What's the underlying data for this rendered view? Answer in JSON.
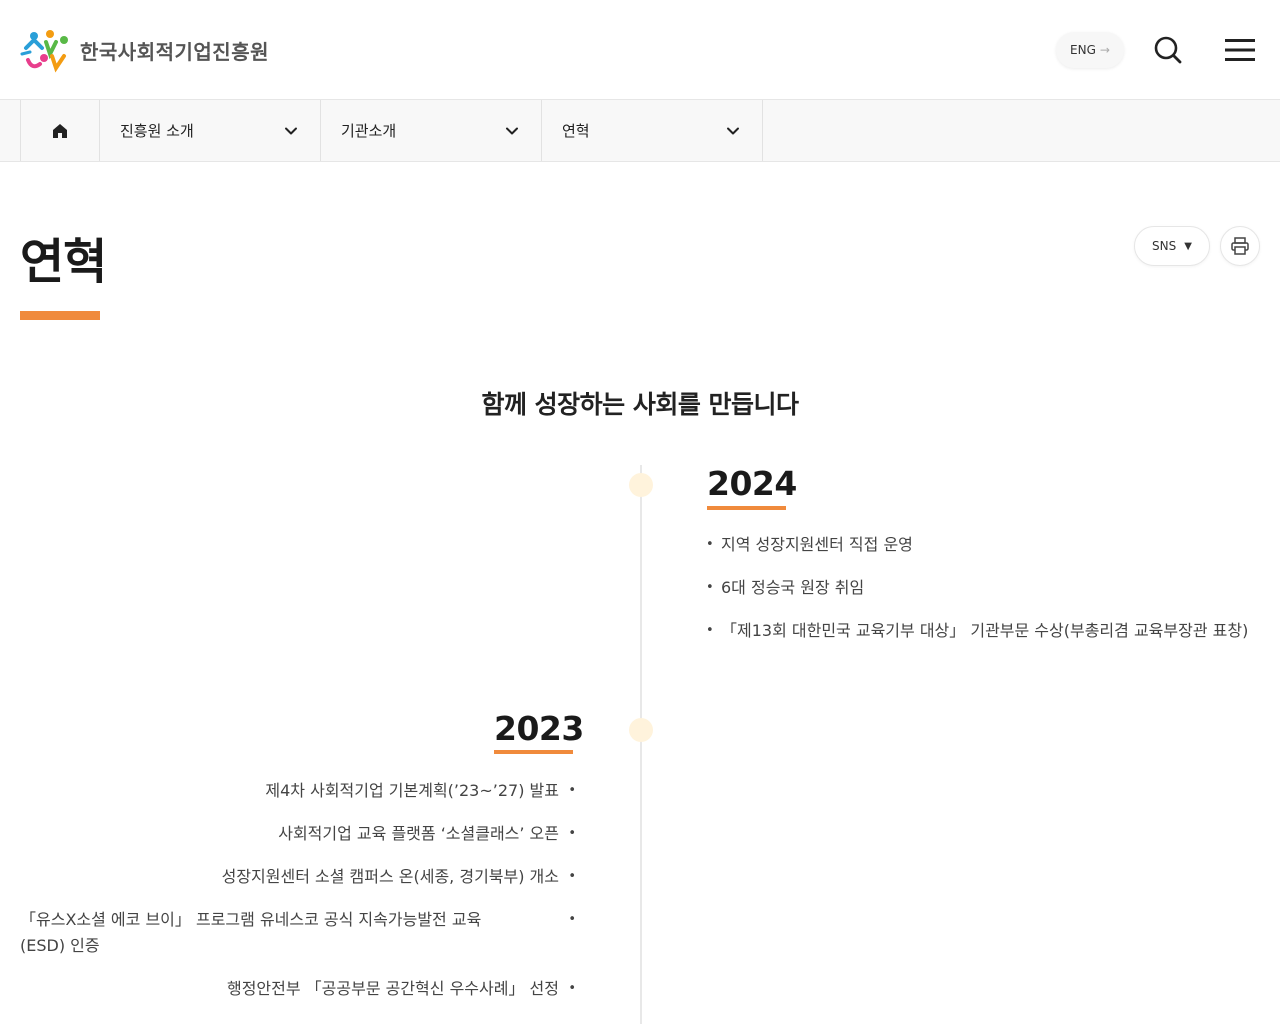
{
  "header": {
    "logo_text": "한국사회적기업진흥원",
    "eng_label": "ENG",
    "colors": {
      "accent": "#f08a3c",
      "logo_blue": "#2a9fd8",
      "logo_green": "#59b947",
      "logo_pink": "#e83e8c",
      "logo_orange": "#f39c12"
    }
  },
  "nav": {
    "items": [
      {
        "label": "진흥원 소개"
      },
      {
        "label": "기관소개"
      },
      {
        "label": "연혁"
      }
    ]
  },
  "page": {
    "title": "연혁",
    "sns_label": "SNS",
    "subtitle": "함께 성장하는 사회를 만듭니다"
  },
  "timeline": [
    {
      "year": "2024",
      "events": [
        "지역 성장지원센터 직접 운영",
        "6대 정승국 원장 취임",
        "「제13회 대한민국 교육기부 대상」 기관부문 수상(부총리겸 교육부장관 표창)"
      ]
    },
    {
      "year": "2023",
      "events": [
        "제4차 사회적기업 기본계획(’23~’27) 발표",
        "사회적기업 교육 플랫폼 ‘소셜클래스’ 오픈",
        "성장지원센터 소셜 캠퍼스 온(세종, 경기북부) 개소",
        "「유스X소셜 에코 브이」 프로그램 유네스코 공식 지속가능발전 교육(ESD) 인증",
        "행정안전부 「공공부문 공간혁신 우수사례」 선정"
      ]
    }
  ]
}
